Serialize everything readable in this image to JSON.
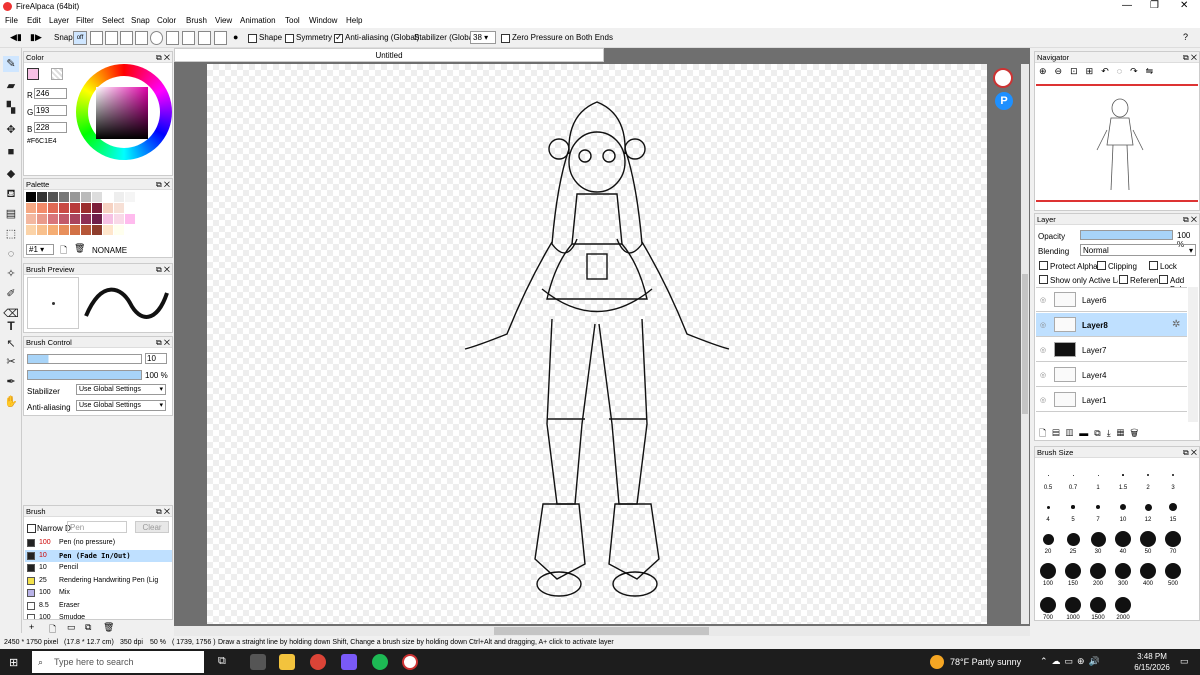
{
  "window": {
    "title": "FireAlpaca (64bit)"
  },
  "menu": [
    "File",
    "Edit",
    "Layer",
    "Filter",
    "Select",
    "Snap",
    "Color",
    "Brush",
    "View",
    "Animation",
    "Tool",
    "Window",
    "Help"
  ],
  "toolbar": {
    "snap_label": "Snap",
    "snap_off": "off",
    "shape_label": "Shape",
    "symmetry_label": "Symmetry",
    "antialias_label": "Anti-aliasing (Global)",
    "stabilizer_label": "Stabilizer (Global)",
    "stabilizer_value": "38",
    "zero_pressure_label": "Zero Pressure on Both Ends"
  },
  "color_panel": {
    "title": "Color",
    "r_label": "R",
    "r": "246",
    "g_label": "G",
    "g": "193",
    "b_label": "B",
    "b": "228",
    "hex": "#F6C1E4",
    "fg_color": "#F6C1E4"
  },
  "palette_panel": {
    "title": "Palette",
    "index": "#1",
    "name": "NONAME"
  },
  "brush_preview": {
    "title": "Brush Preview"
  },
  "brush_control": {
    "title": "Brush Control",
    "size_value": "10",
    "opacity_value": "100 %",
    "stabilizer_label": "Stabilizer",
    "stabilizer_value": "Use Global Settings",
    "antialias_label": "Anti-aliasing",
    "antialias_value": "Use Global Settings"
  },
  "brush_panel": {
    "title": "Brush",
    "narrow_label": "Narrow D",
    "search_placeholder": "Pen",
    "clear_label": "Clear",
    "items": [
      {
        "size": "100",
        "name": "Pen (no pressure)",
        "color": "#222222"
      },
      {
        "size": "10",
        "name": "Pen (Fade In/Out)",
        "color": "#222222"
      },
      {
        "size": "10",
        "name": "Pencil",
        "color": "#222222"
      },
      {
        "size": "25",
        "name": "Rendering Handwriting Pen (Lig",
        "color": "#f3e24a"
      },
      {
        "size": "100",
        "name": "Mix",
        "color": "#b9b3e8"
      },
      {
        "size": "8.5",
        "name": "Eraser",
        "color": "#ffffff"
      },
      {
        "size": "100",
        "name": "Smudge",
        "color": "#ffffff"
      }
    ]
  },
  "canvas": {
    "tab_title": "Untitled"
  },
  "navigator": {
    "title": "Navigator"
  },
  "layer_panel": {
    "title": "Layer",
    "opacity_label": "Opacity",
    "opacity_value": "100 %",
    "blending_label": "Blending",
    "blending_value": "Normal",
    "protect_alpha": "Protect Alpha",
    "clipping": "Clipping",
    "lock": "Lock",
    "show_only_active": "Show only Active Laye",
    "reference": "Referen",
    "add_below": "Add Belo",
    "layers": [
      {
        "name": "Layer6"
      },
      {
        "name": "Layer8"
      },
      {
        "name": "Layer7"
      },
      {
        "name": "Layer4"
      },
      {
        "name": "Layer1"
      }
    ]
  },
  "brush_size_panel": {
    "title": "Brush Size",
    "sizes": [
      [
        "0.5",
        "0.7",
        "1",
        "1.5",
        "2",
        "3"
      ],
      [
        "4",
        "5",
        "7",
        "10",
        "12",
        "15"
      ],
      [
        "20",
        "25",
        "30",
        "40",
        "50",
        "70"
      ],
      [
        "100",
        "150",
        "200",
        "300",
        "400",
        "500"
      ],
      [
        "700",
        "1000",
        "1500",
        "2000"
      ]
    ]
  },
  "status": {
    "dimensions": "2450 * 1750 pixel",
    "size_cm": "(17.8 * 12.7 cm)",
    "dpi": "350 dpi",
    "zoom": "50 %",
    "coords": "( 1739, 1756 )",
    "hint": "Draw a straight line by holding down Shift, Change a brush size by holding down Ctrl+Alt and dragging, A+ click to activate layer"
  },
  "taskbar": {
    "search_placeholder": "Type here to search",
    "weather": "78°F  Partly sunny",
    "time": "3:48 PM",
    "date": "6/15/2026"
  }
}
